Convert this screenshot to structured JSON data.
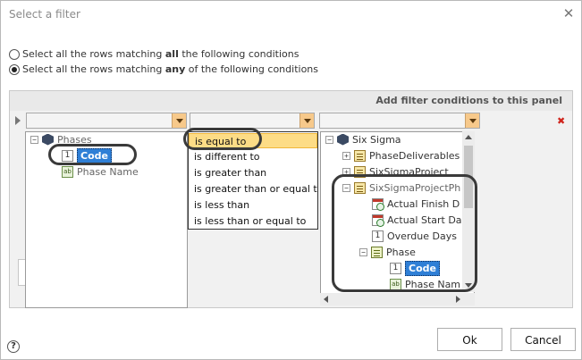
{
  "dialog": {
    "title": "Select a filter",
    "close_glyph": "✕"
  },
  "mode": {
    "all_prefix": "Select all the rows matching ",
    "all_keyword": "all",
    "all_suffix": " the following conditions",
    "any_prefix": "Select all the rows matching ",
    "any_keyword": "any",
    "any_suffix": " of the following conditions",
    "selected": "any"
  },
  "panel": {
    "header": "Add filter conditions to this panel",
    "delete_glyph": "✖"
  },
  "field_tree": {
    "root": {
      "label": "Phases",
      "icon": "hexagon-entity-icon",
      "expander": "−"
    },
    "items": [
      {
        "label": "Code",
        "icon": "number-field-icon",
        "icon_text": "1",
        "selected": true
      },
      {
        "label": "Phase Name",
        "icon": "text-field-icon",
        "icon_text": "ab",
        "selected": false
      }
    ]
  },
  "operators": {
    "items": [
      "is equal to",
      "is different to",
      "is greater than",
      "is greater than or equal t",
      "is less than",
      "is less than or equal to"
    ],
    "selected_index": 0
  },
  "value_tree": {
    "root": {
      "label": "Six Sigma",
      "icon": "hexagon-entity-icon",
      "expander": "−"
    },
    "items": [
      {
        "label": "PhaseDeliverables",
        "icon": "entity-icon",
        "expander": "+"
      },
      {
        "label": "SixSigmaProject",
        "icon": "entity-icon",
        "expander": "+"
      },
      {
        "label": "SixSigmaProjectPh",
        "icon": "entity-icon",
        "expander": "−"
      },
      {
        "label": "Actual Finish D",
        "icon": "date-field-icon"
      },
      {
        "label": "Actual Start Da",
        "icon": "date-field-icon"
      },
      {
        "label": "Overdue Days",
        "icon": "number-field-icon",
        "icon_text": "1"
      },
      {
        "label": "Phase",
        "icon": "list-entity-icon",
        "expander": "−"
      },
      {
        "label": "Code",
        "icon": "number-field-icon",
        "icon_text": "1",
        "selected": true
      },
      {
        "label": "Phase Nam",
        "icon": "text-field-icon",
        "icon_text": "ab"
      }
    ]
  },
  "buttons": {
    "ok": "Ok",
    "cancel": "Cancel",
    "help": "?"
  }
}
